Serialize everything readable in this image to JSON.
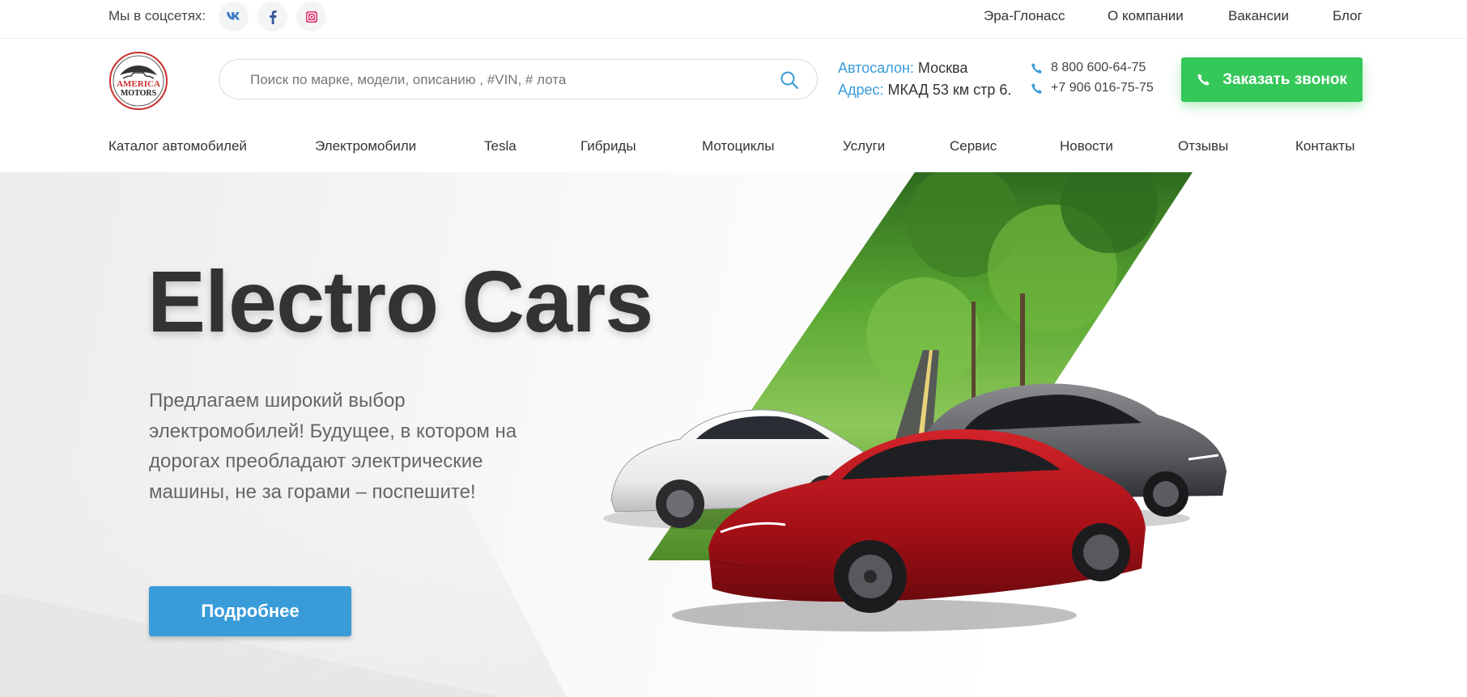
{
  "topbar": {
    "social_label": "Мы в соцсетях:",
    "social": [
      {
        "name": "vk-icon",
        "glyph": "VK",
        "color": "#3a7cc4"
      },
      {
        "name": "facebook-icon",
        "glyph": "f",
        "color": "#3b5998"
      },
      {
        "name": "instagram-icon",
        "glyph": "ig",
        "color": "#e1306c"
      }
    ],
    "links": [
      "Эра-Глонасс",
      "О компании",
      "Вакансии",
      "Блог"
    ]
  },
  "header": {
    "logo_text_top": "AMERICA",
    "logo_text_bottom": "MOTORS",
    "search_placeholder": "Поиск по марке, модели, описанию , #VIN, # лота",
    "showroom_key": "Автосалон:",
    "showroom_value": "Москва",
    "address_key": "Адрес:",
    "address_value": "МКАД 53 км стр 6.",
    "phone_1": "8 800 600-64-75",
    "phone_2": "+7 906 016-75-75",
    "call_button": "Заказать звонок"
  },
  "nav": {
    "items": [
      "Каталог автомобилей",
      "Электромобили",
      "Tesla",
      "Гибриды",
      "Мотоциклы",
      "Услуги",
      "Сервис",
      "Новости",
      "Отзывы",
      "Контакты"
    ]
  },
  "hero": {
    "title": "Electro Cars",
    "text": "Предлагаем широкий выбор электромобилей! Будущее, в котором на дорогах преобладают электрические машины, не за горами – поспешите!",
    "button": "Подробнее"
  },
  "colors": {
    "accent_blue": "#3a9bd9",
    "call_green": "#34c759",
    "text_dark": "#333333"
  }
}
